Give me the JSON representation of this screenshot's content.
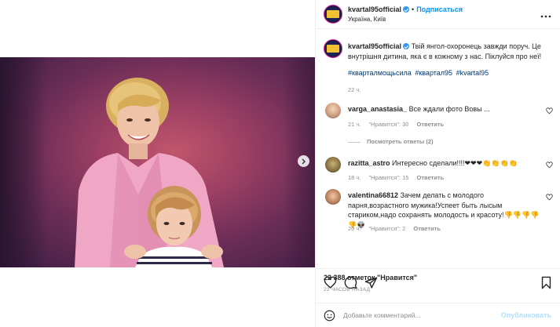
{
  "post": {
    "username": "kvartal95official",
    "follow_label": "Подписаться",
    "dot": "•",
    "location": "Україна, Київ",
    "more_icon": "more-horizontal-icon"
  },
  "caption": {
    "username": "kvartal95official",
    "text": "Твій янгол-охоронець завжди поруч. Це внутрішня дитина, яка є в кожному з нас. Піклуйся про неї!",
    "hashtags": [
      "#кварталмощьсила",
      "#квартал95",
      "#kvartal95"
    ],
    "time": "22 ч."
  },
  "comments": [
    {
      "username": "varga_anastasia_",
      "text": "Все ждали фото Вовы ...",
      "time": "21 ч.",
      "likes": "\"Нравится\": 30",
      "reply": "Ответить",
      "view_replies": "Посмотреть ответы (2)"
    },
    {
      "username": "razitta_astro",
      "text": "Интересно сделали!!!!❤❤❤👏👏👏👏",
      "time": "18 ч.",
      "likes": "\"Нравится\": 15",
      "reply": "Ответить"
    },
    {
      "username": "valentina66812",
      "text": "Зачем делать с молодого парня,возрастного мужика!Успеет быть лысым стариком,надо сохранять молодость и красоту!👎👎👎👎👎👽",
      "time": "20 ч.",
      "likes": "\"Нравится\": 2",
      "reply": "Ответить"
    }
  ],
  "stats": {
    "likes_text": "22 388 отметок \"Нравится\"",
    "posted_ago": "22 ЧАСОВ НАЗАД"
  },
  "add_comment": {
    "placeholder": "Добавьте комментарий...",
    "publish_label": "Опубликовать"
  },
  "colors": {
    "accent": "#0095f6",
    "verified": "#3897f0",
    "muted": "#8e8e8e",
    "hashtag": "#00376b",
    "publish_disabled": "#b2dffc"
  }
}
